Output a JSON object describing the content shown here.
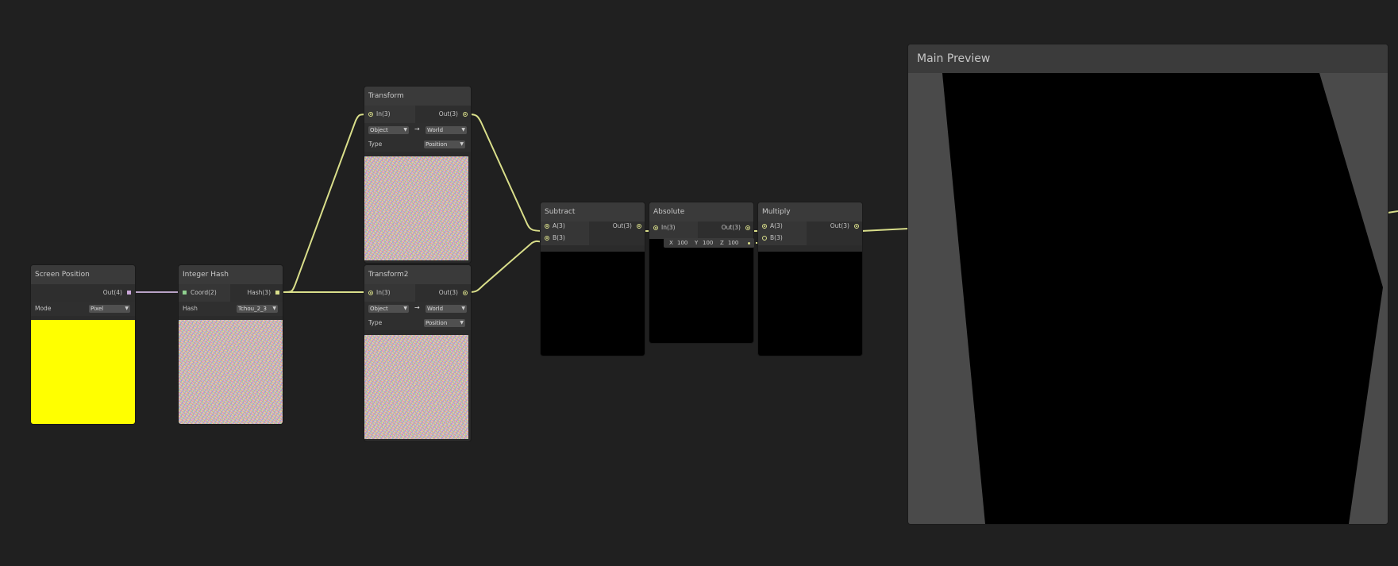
{
  "nodes": {
    "screen_position": {
      "title": "Screen Position",
      "out_label": "Out(4)",
      "mode_label": "Mode",
      "mode_value": "Pixel",
      "preview_color": "#ffff00"
    },
    "integer_hash": {
      "title": "Integer Hash",
      "in_label": "Coord(2)",
      "out_label": "Hash(3)",
      "hash_label": "Hash",
      "hash_value": "Tchou_2_3"
    },
    "transform": {
      "title": "Transform",
      "in_label": "In(3)",
      "out_label": "Out(3)",
      "from_space": "Object",
      "to_space": "World",
      "arrow": "→",
      "type_label": "Type",
      "type_value": "Position"
    },
    "transform2": {
      "title": "Transform2",
      "in_label": "In(3)",
      "out_label": "Out(3)",
      "from_space": "Object",
      "to_space": "World",
      "arrow": "→",
      "type_label": "Type",
      "type_value": "Position"
    },
    "subtract": {
      "title": "Subtract",
      "a_label": "A(3)",
      "b_label": "B(3)",
      "out_label": "Out(3)"
    },
    "absolute": {
      "title": "Absolute",
      "in_label": "In(3)",
      "out_label": "Out(3)"
    },
    "multiply": {
      "title": "Multiply",
      "a_label": "A(3)",
      "b_label": "B(3)",
      "out_label": "Out(3)",
      "b_default": {
        "x_label": "X",
        "x_value": "100",
        "y_label": "Y",
        "y_value": "100",
        "z_label": "Z",
        "z_value": "100"
      }
    }
  },
  "main_preview": {
    "title": "Main Preview"
  },
  "colors": {
    "canvas": "#202020",
    "vector3_edge": "#d9de8a",
    "vector2_edge": "#8fcf8f",
    "vector4_edge": "#c9a6d8"
  }
}
